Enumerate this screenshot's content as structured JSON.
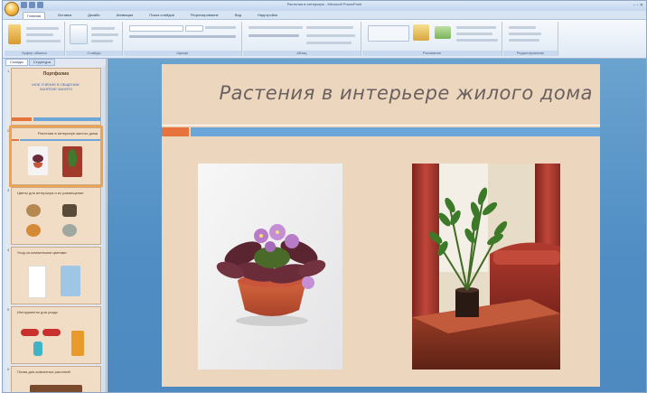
{
  "app": {
    "window_title": "Растения в интерьере - Microsoft PowerPoint"
  },
  "ribbon_tabs": [
    "Главная",
    "Вставка",
    "Дизайн",
    "Анимация",
    "Показ слайдов",
    "Рецензирование",
    "Вид",
    "Надстройки"
  ],
  "ribbon_groups": [
    "Буфер обмена",
    "Слайды",
    "Шрифт",
    "Абзац",
    "Рисование",
    "Редактирование"
  ],
  "pane_tabs": [
    "Слайды",
    "Структура"
  ],
  "thumbnails": [
    {
      "num": "1",
      "title": "Портфолио",
      "subtitle": "МОЕ УЧЕНИЕ В ОБЩЕНИИ. ЗАНЯТИЕ ЗАНЯТО"
    },
    {
      "num": "2",
      "title": "Растения в интерьере жилого дома"
    },
    {
      "num": "3",
      "title": "Цветы для интерьера и их размещение"
    },
    {
      "num": "4",
      "title": "Уход за комнатными цветами"
    },
    {
      "num": "5",
      "title": "Инструменты для ухода"
    },
    {
      "num": "6",
      "title": "Почва для комнатных растений"
    }
  ],
  "slide": {
    "title": "Растения в интерьере жилого дома"
  },
  "colors": {
    "slide_bg": "#ecd6bd",
    "accent_orange": "#e6733d",
    "accent_blue": "#6aa7d8",
    "stage_bg": "#4f8dc4"
  }
}
